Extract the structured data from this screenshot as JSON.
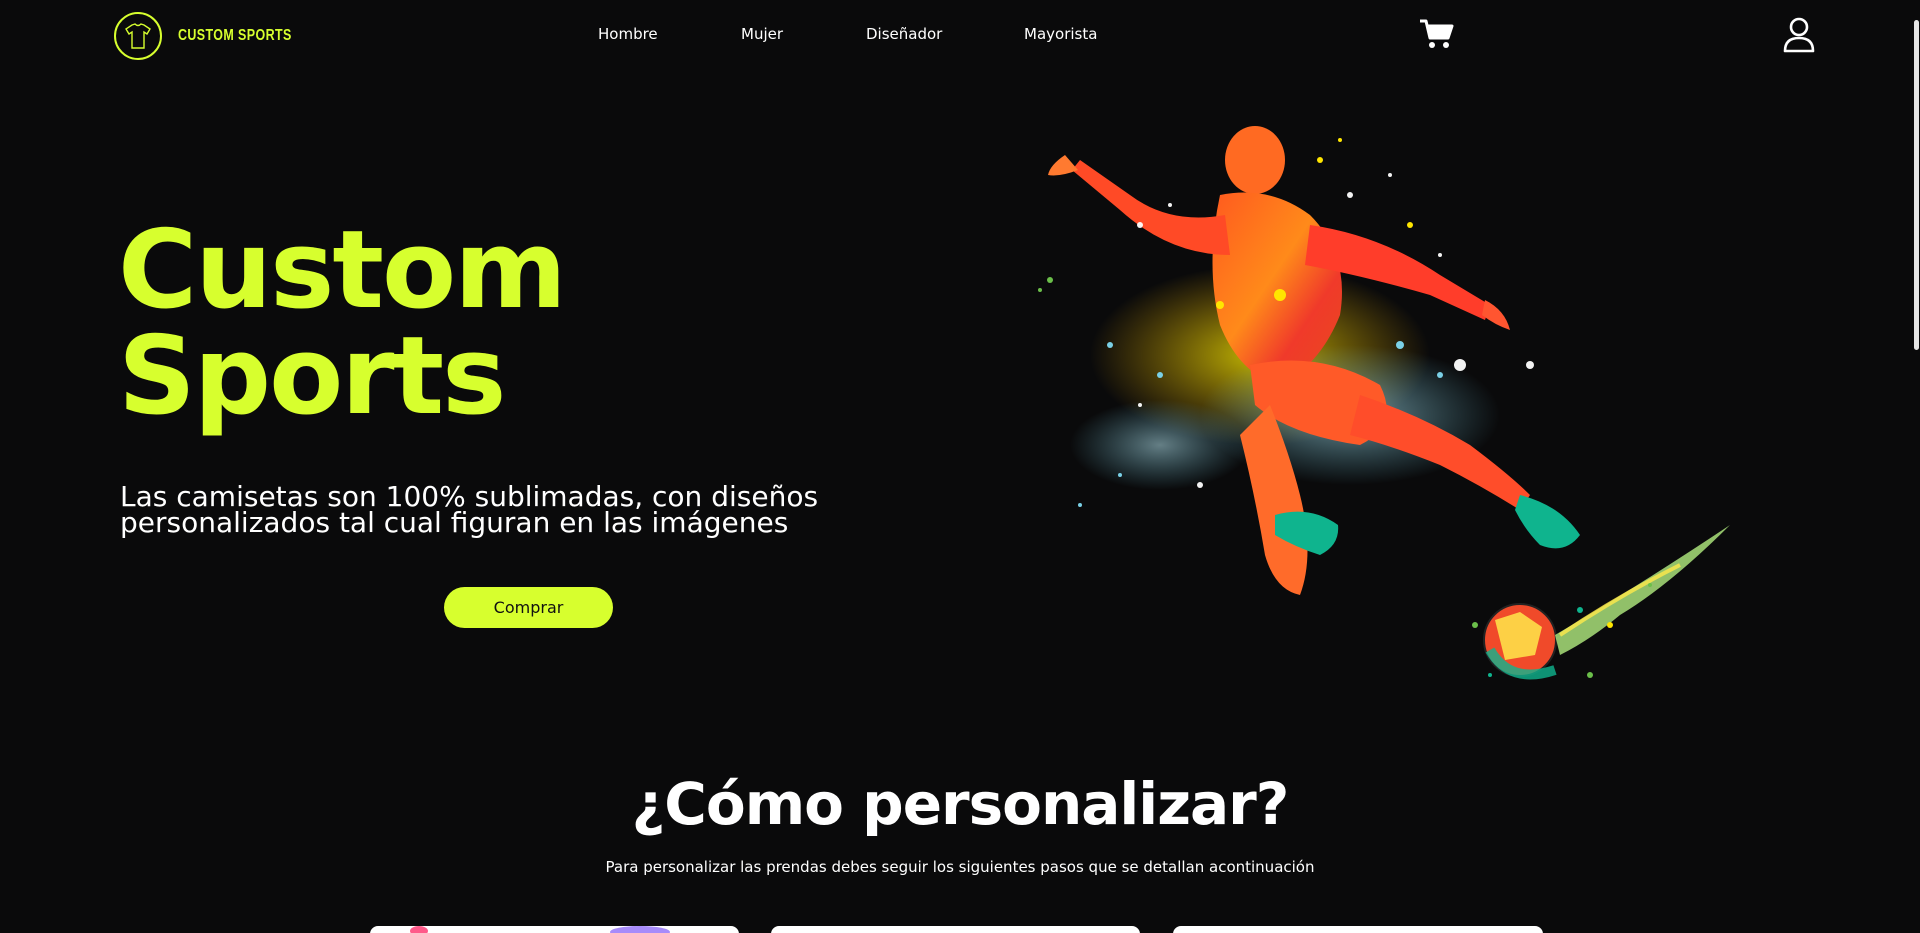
{
  "brand": {
    "name": "CUSTOM SPORTS",
    "accent": "#d7ff2e",
    "background": "#0a0a0b"
  },
  "nav": {
    "links": [
      "Hombre",
      "Mujer",
      "Diseñador",
      "Mayorista"
    ],
    "cart_icon": "cart-icon",
    "user_icon": "user-icon"
  },
  "hero": {
    "title_line1": "Custom",
    "title_line2": "Sports",
    "subtitle_line1": "Las camisetas son 100% sublimadas, con diseños",
    "subtitle_line2": "personalizados tal cual figuran en las imágenes",
    "cta": "Comprar"
  },
  "how": {
    "title": "¿Cómo personalizar?",
    "subtitle": "Para personalizar las prendas debes seguir los siguientes pasos que se detallan acontinuación"
  }
}
